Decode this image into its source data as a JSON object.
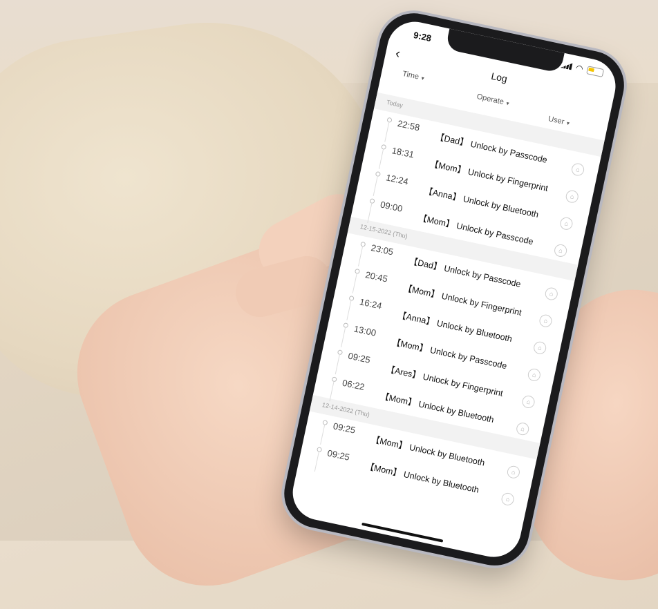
{
  "status": {
    "time": "9:28"
  },
  "nav": {
    "title": "Log",
    "back_icon": "chevron-left-icon"
  },
  "filters": {
    "time": "Time",
    "operate": "Operate",
    "user": "User"
  },
  "sections": [
    {
      "label": "Today",
      "entries": [
        {
          "time": "22:58",
          "text": "【Dad】 Unlock by Passcode"
        },
        {
          "time": "18:31",
          "text": "【Mom】 Unlock by Fingerprint"
        },
        {
          "time": "12:24",
          "text": "【Anna】 Unlock by Bluetooth"
        },
        {
          "time": "09:00",
          "text": "【Mom】 Unlock by Passcode"
        }
      ]
    },
    {
      "label": "12-15-2022 (Thu)",
      "entries": [
        {
          "time": "23:05",
          "text": "【Dad】 Unlock by Passcode"
        },
        {
          "time": "20:45",
          "text": "【Mom】 Unlock by Fingerprint"
        },
        {
          "time": "16:24",
          "text": "【Anna】 Unlock by Bluetooth"
        },
        {
          "time": "13:00",
          "text": "【Mom】 Unlock by Passcode"
        },
        {
          "time": "09:25",
          "text": "【Ares】 Unlock by Fingerprint"
        },
        {
          "time": "06:22",
          "text": "【Mom】 Unlock by Bluetooth"
        }
      ]
    },
    {
      "label": "12-14-2022 (Thu)",
      "entries": [
        {
          "time": "09:25",
          "text": "【Mom】 Unlock by Bluetooth"
        },
        {
          "time": "09:25",
          "text": "【Mom】 Unlock by Bluetooth"
        }
      ]
    }
  ],
  "colors": {
    "battery": "#f5c400",
    "section_bg": "#f2f2f2"
  }
}
